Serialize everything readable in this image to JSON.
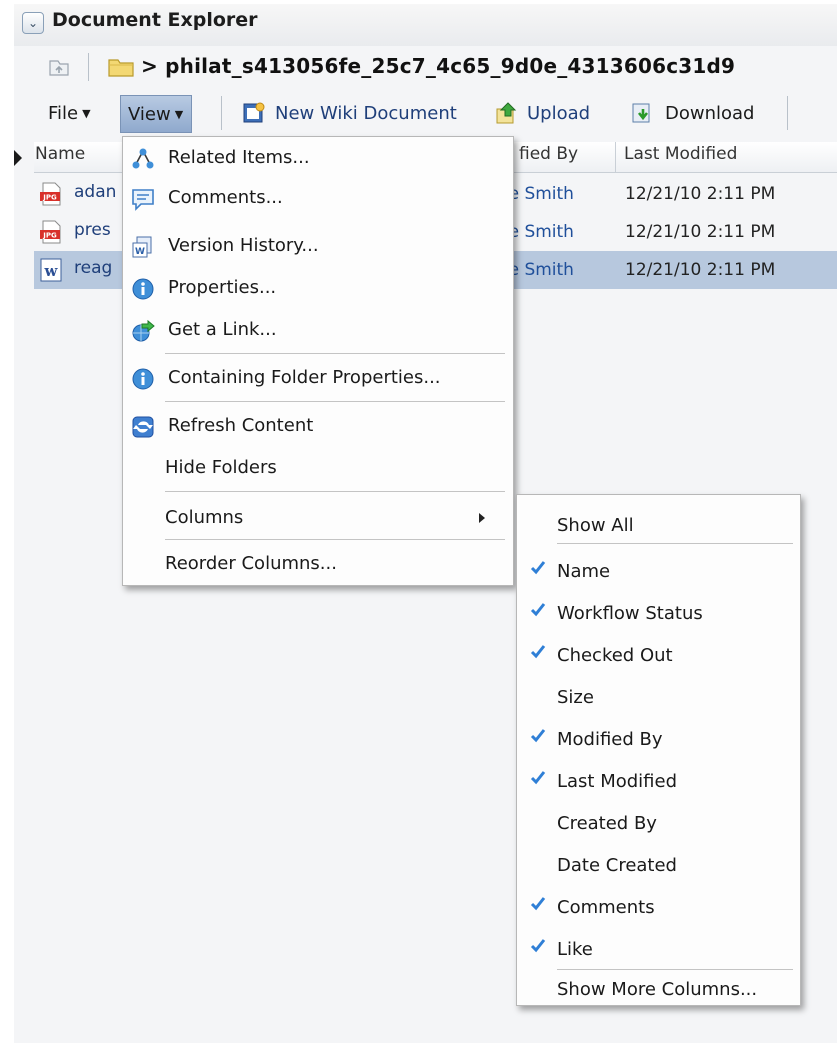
{
  "header": {
    "title": "Document Explorer"
  },
  "path": {
    "text": "> philat_s413056fe_25c7_4c65_9d0e_4313606c31d9"
  },
  "toolbar": {
    "file_label": "File",
    "view_label": "View",
    "new_wiki_label": "New Wiki Document",
    "upload_label": "Upload",
    "download_label": "Download"
  },
  "table": {
    "columns": {
      "name": "Name",
      "modified_by": "fied By",
      "last_modified": "Last Modified"
    },
    "rows": [
      {
        "name": "adan",
        "type": "JPG",
        "modified_by": "sie Smith",
        "last_modified": "12/21/10 2:11 PM",
        "selected": false
      },
      {
        "name": "pres",
        "type": "JPG",
        "modified_by": "sie Smith",
        "last_modified": "12/21/10 2:11 PM",
        "selected": false
      },
      {
        "name": "reag",
        "type": "W",
        "modified_by": "sie Smith",
        "last_modified": "12/21/10 2:11 PM",
        "selected": true
      }
    ]
  },
  "view_menu": {
    "items": [
      {
        "label": "Related Items...",
        "icon": "related-items-icon"
      },
      {
        "label": "Comments...",
        "icon": "comments-icon"
      },
      {
        "label": "Version History...",
        "icon": "version-history-icon"
      },
      {
        "label": "Properties...",
        "icon": "info-icon"
      },
      {
        "label": "Get a Link...",
        "icon": "link-globe-icon"
      },
      {
        "label": "Containing Folder Properties...",
        "icon": "info-icon"
      },
      {
        "label": "Refresh Content",
        "icon": "refresh-icon"
      },
      {
        "label": "Hide Folders"
      },
      {
        "label": "Columns"
      },
      {
        "label": "Reorder Columns..."
      }
    ]
  },
  "columns_submenu": {
    "items": [
      {
        "label": "Show All",
        "checked": false
      },
      {
        "label": "Name",
        "checked": true
      },
      {
        "label": "Workflow Status",
        "checked": true
      },
      {
        "label": "Checked Out",
        "checked": true
      },
      {
        "label": "Size",
        "checked": false
      },
      {
        "label": "Modified By",
        "checked": true
      },
      {
        "label": "Last Modified",
        "checked": true
      },
      {
        "label": "Created By",
        "checked": false
      },
      {
        "label": "Date Created",
        "checked": false
      },
      {
        "label": "Comments",
        "checked": true
      },
      {
        "label": "Like",
        "checked": true
      },
      {
        "label": "Show More Columns...",
        "checked": false
      }
    ]
  },
  "colors": {
    "link": "#1f3f7a",
    "selection": "#b7c8de",
    "check": "#2f7fd6",
    "view_active": "#9fb6d6"
  }
}
